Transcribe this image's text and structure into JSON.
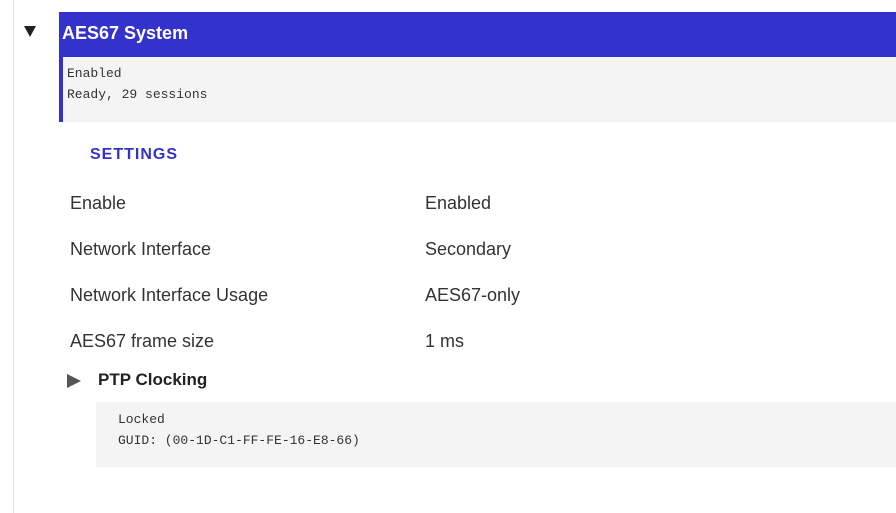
{
  "section": {
    "title": "AES67 System",
    "status_lines": [
      "Enabled",
      "Ready, 29 sessions"
    ]
  },
  "settings": {
    "heading": "SETTINGS",
    "rows": [
      {
        "label": "Enable",
        "value": "Enabled"
      },
      {
        "label": "Network Interface",
        "value": "Secondary"
      },
      {
        "label": "Network Interface Usage",
        "value": "AES67-only"
      },
      {
        "label": "AES67 frame size",
        "value": "1 ms"
      }
    ]
  },
  "ptp": {
    "title": "PTP Clocking",
    "status_lines": [
      "Locked",
      "GUID: (00-1D-C1-FF-FE-16-E8-66)"
    ]
  },
  "colors": {
    "accent": "#3333cc",
    "header_text": "#ffffff",
    "panel_bg": "#f4f4f4"
  },
  "icons": {
    "main_toggle": "triangle-down-icon",
    "ptp_toggle": "triangle-right-icon"
  }
}
